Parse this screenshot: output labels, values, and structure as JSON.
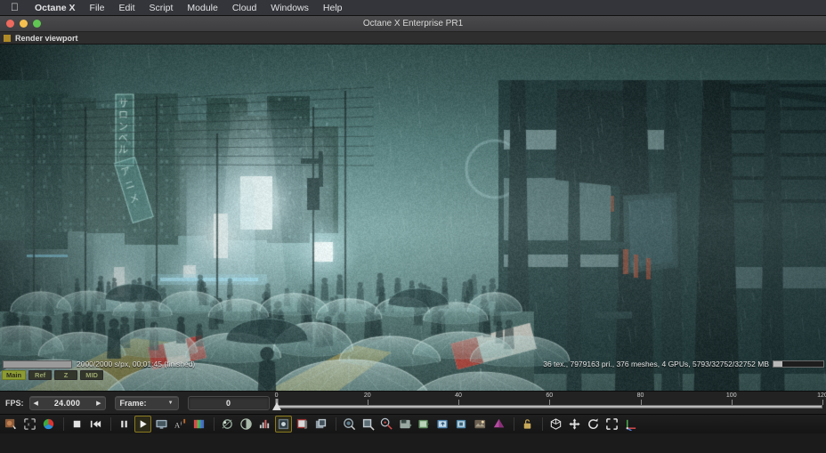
{
  "menubar": {
    "apple_icon": "apple-logo-icon",
    "items": [
      {
        "label": "Octane X",
        "bold": true
      },
      {
        "label": "File",
        "bold": false
      },
      {
        "label": "Edit",
        "bold": false
      },
      {
        "label": "Script",
        "bold": false
      },
      {
        "label": "Module",
        "bold": false
      },
      {
        "label": "Cloud",
        "bold": false
      },
      {
        "label": "Windows",
        "bold": false
      },
      {
        "label": "Help",
        "bold": false
      }
    ]
  },
  "window": {
    "title": "Octane X Enterprise PR1",
    "traffic_lights": [
      "close-button",
      "minimize-button",
      "maximize-button"
    ]
  },
  "viewport_tab": {
    "label": "Render viewport",
    "marker_color": "#b08a26"
  },
  "render_status": {
    "progress_percent": 100,
    "progress_text": "2000/2000 s/px, 00:01:45 (finished)",
    "scene_stats": "36 tex., 7979163 pri., 376 meshes, 4 GPUs, 5793/32752/32752 MB",
    "memory_percent": 18
  },
  "passes": [
    {
      "label": "Main",
      "state": "active"
    },
    {
      "label": "Ref",
      "state": "dim"
    },
    {
      "label": "Z",
      "state": "dim"
    },
    {
      "label": "MID",
      "state": "dim"
    }
  ],
  "animation": {
    "fps_label": "FPS:",
    "fps_value": "24.000",
    "fps_dec_icon": "left-arrow-icon",
    "fps_inc_icon": "right-arrow-icon",
    "frame_label": "Frame:",
    "frame_chevron_icon": "chevron-down-icon",
    "frame_value": "0"
  },
  "timeline": {
    "ticks": [
      0,
      20,
      40,
      60,
      80,
      100,
      120
    ],
    "range_min": 0,
    "range_max": 120,
    "playhead": 0
  },
  "toolbar": {
    "groups": [
      {
        "buttons": [
          {
            "name": "region-render-icon",
            "selected": false
          },
          {
            "name": "resolution-icon",
            "selected": false
          },
          {
            "name": "color-wheel-icon",
            "selected": false
          }
        ]
      },
      {
        "buttons": [
          {
            "name": "stop-icon",
            "selected": false
          },
          {
            "name": "rewind-to-start-icon",
            "selected": false
          }
        ]
      },
      {
        "buttons": [
          {
            "name": "pause-icon",
            "selected": false
          },
          {
            "name": "play-icon",
            "selected": true
          },
          {
            "name": "monitor-icon",
            "selected": false
          },
          {
            "name": "text-overlay-icon",
            "selected": false
          },
          {
            "name": "color-grade-icon",
            "selected": false
          }
        ]
      },
      {
        "buttons": [
          {
            "name": "lens-flare-icon",
            "selected": false
          },
          {
            "name": "denoise-icon",
            "selected": false
          },
          {
            "name": "histogram-icon",
            "selected": false
          },
          {
            "name": "imager-settings-icon",
            "selected": true
          },
          {
            "name": "render-passes-icon",
            "selected": false
          },
          {
            "name": "layers-icon",
            "selected": false
          }
        ]
      },
      {
        "buttons": [
          {
            "name": "pick-material-icon",
            "selected": false
          },
          {
            "name": "pick-object-icon",
            "selected": false
          },
          {
            "name": "focus-picker-icon",
            "selected": false
          },
          {
            "name": "save-image-icon",
            "selected": false
          },
          {
            "name": "copy-image-icon",
            "selected": false
          },
          {
            "name": "export-image-icon",
            "selected": false
          },
          {
            "name": "render-target-icon",
            "selected": false
          },
          {
            "name": "environment-icon",
            "selected": false
          },
          {
            "name": "clay-mode-icon",
            "selected": false
          }
        ]
      },
      {
        "buttons": [
          {
            "name": "lock-icon",
            "selected": false
          }
        ]
      },
      {
        "buttons": [
          {
            "name": "box-select-icon",
            "selected": false
          },
          {
            "name": "move-tool-icon",
            "selected": false
          },
          {
            "name": "rotate-tool-icon",
            "selected": false
          },
          {
            "name": "scale-tool-icon",
            "selected": false
          },
          {
            "name": "axis-gizmo-icon",
            "selected": false
          }
        ]
      }
    ]
  },
  "scene": {
    "description": "Rendered night city street in rain with crowd of transparent umbrellas, neon Japanese signage and glowing storefronts",
    "signage": [
      "サロンベル",
      "アニメ"
    ]
  }
}
